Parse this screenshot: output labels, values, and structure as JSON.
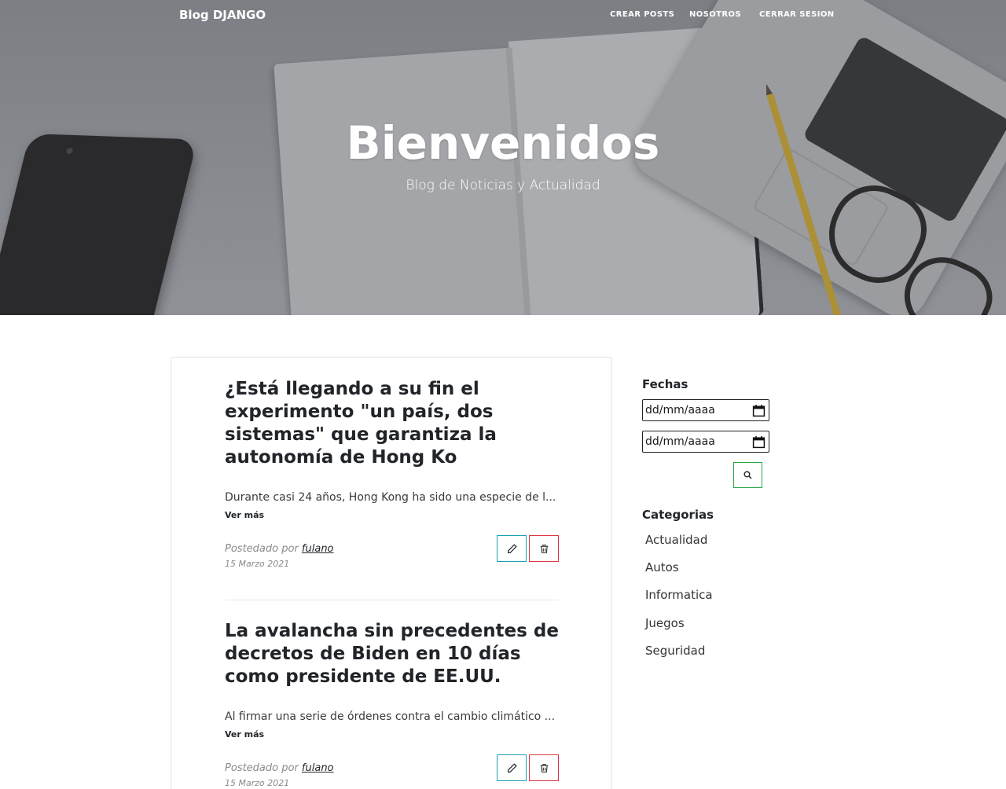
{
  "nav": {
    "brand": "Blog DJANGO",
    "links": [
      "CREAR POSTS",
      "NOSOTROS",
      "CERRAR SESION"
    ]
  },
  "hero": {
    "title": "Bienvenidos",
    "subtitle": "Blog de Noticias y Actualidad"
  },
  "posts": [
    {
      "title": "¿Está llegando a su fin el experimento \"un país, dos sistemas\" que garantiza la autonomía de Hong Ko",
      "excerpt": "Durante casi 24 años, Hong Kong ha sido una especie de l...",
      "more": "Ver más",
      "posted_by_label": "Postedado por",
      "author": "fulano",
      "date": "15 Marzo 2021"
    },
    {
      "title": "La avalancha sin precedentes de decretos de Biden en 10 días como presidente de EE.UU.",
      "excerpt": "Al firmar una serie de órdenes contra el cambio climático ...",
      "more": "Ver más",
      "posted_by_label": "Postedado por",
      "author": "fulano",
      "date": "15 Marzo 2021"
    }
  ],
  "sidebar": {
    "dates_heading": "Fechas",
    "date_from": "dd/mm/aaaa",
    "date_to": "dd/mm/aaaa",
    "categories_heading": "Categorias",
    "categories": [
      "Actualidad",
      "Autos",
      "Informatica",
      "Juegos",
      "Seguridad"
    ]
  },
  "colors": {
    "edit_border": "#17a2b8",
    "delete_border": "#dc3545",
    "search_border": "#28a745"
  },
  "icons": {
    "edit": "pencil-icon",
    "delete": "trash-icon",
    "search": "search-icon",
    "calendar": "calendar-icon"
  }
}
